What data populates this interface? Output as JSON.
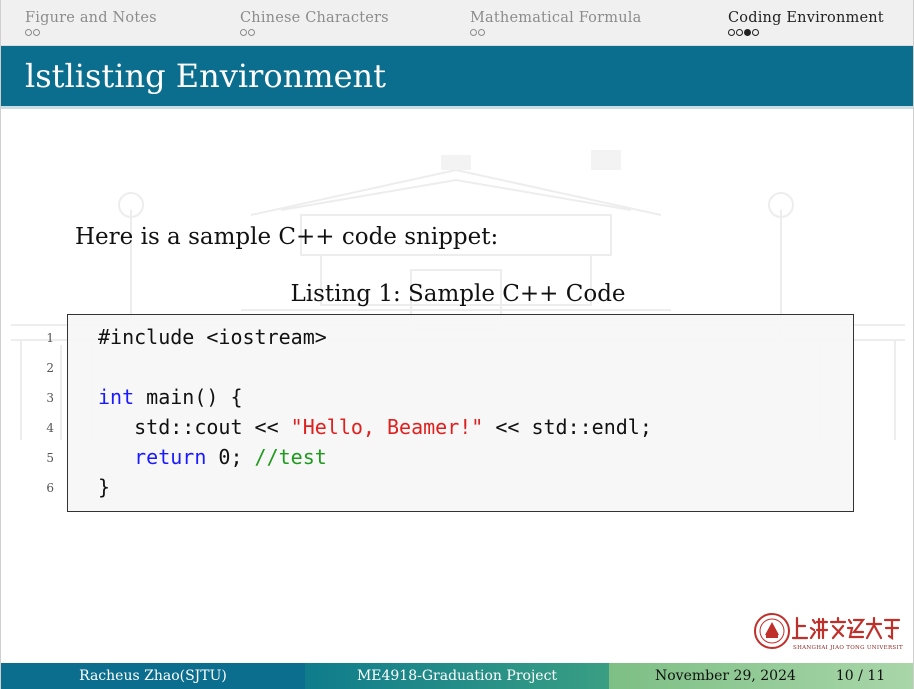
{
  "nav": {
    "sections": [
      {
        "label": "Figure and Notes",
        "dots": [
          false,
          false
        ]
      },
      {
        "label": "Chinese Characters",
        "dots": [
          false,
          false
        ]
      },
      {
        "label": "Mathematical Formula",
        "dots": [
          false,
          false
        ]
      },
      {
        "label": "Coding Environment",
        "dots": [
          false,
          false,
          true,
          false
        ]
      }
    ]
  },
  "frame": {
    "title": "lstlisting Environment"
  },
  "body": {
    "intro": "Here is a sample C++ code snippet:",
    "caption": "Listing 1: Sample C++ Code"
  },
  "code": {
    "line_numbers": [
      "1",
      "2",
      "3",
      "4",
      "5",
      "6"
    ],
    "lines": [
      "#include <iostream>",
      "",
      "int main() {",
      "   std::cout << \"Hello, Beamer!\" << std::endl;",
      "   return 0; //test",
      "}"
    ],
    "tokens": {
      "kw_int": "int",
      "main_rest": " main() {",
      "cout_pre": "   std::cout << ",
      "cout_str": "\"Hello, Beamer!\"",
      "cout_post": " << std::endl;",
      "indent": "   ",
      "kw_return": "return",
      "return_rest": " 0; ",
      "comment": "//test"
    },
    "colors": {
      "keyword": "#1a1aff",
      "string": "#e0201f",
      "comment": "#1f9a1f"
    }
  },
  "logo": {
    "name": "Shanghai Jiao Tong University",
    "chinese": "上海交通大学",
    "icon": "sjtu-seal-icon"
  },
  "footer": {
    "author": "Racheus Zhao(SJTU)",
    "project": "ME4918-Graduation Project",
    "date": "November 29, 2024",
    "page": "10 / 11"
  },
  "colors": {
    "title_bar": "#0b6e8e",
    "footer_left": "#0b6e8e",
    "footer_right": "#a9d6a9"
  }
}
